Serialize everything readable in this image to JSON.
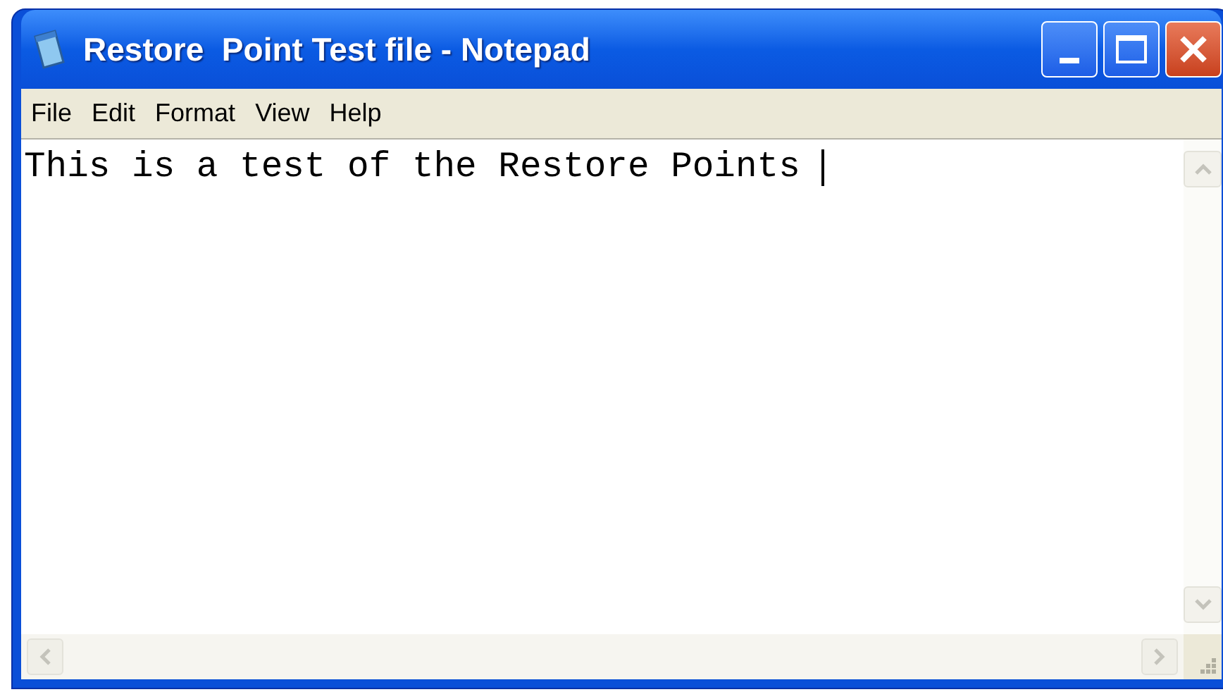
{
  "window": {
    "title": "Restore  Point Test file - Notepad"
  },
  "menu": [
    {
      "label": "File"
    },
    {
      "label": "Edit"
    },
    {
      "label": "Format"
    },
    {
      "label": "View"
    },
    {
      "label": "Help"
    }
  ],
  "editor": {
    "value": "This is a test of the Restore Points "
  }
}
